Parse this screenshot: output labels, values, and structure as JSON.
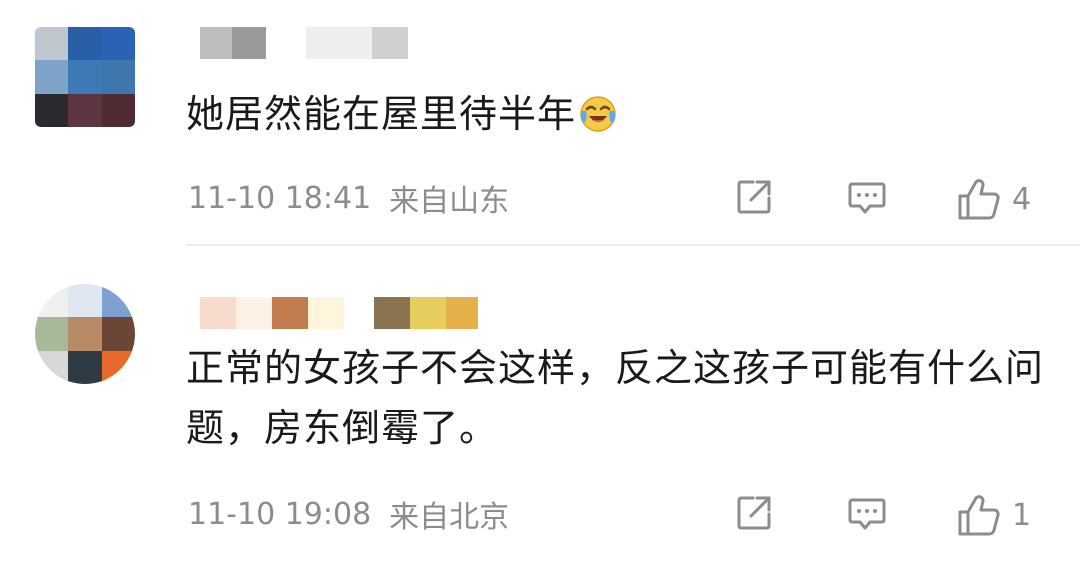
{
  "comments": [
    {
      "avatar_colors": [
        "#bfc7cf",
        "#2a5fa8",
        "#2a63b3",
        "#7ea3c8",
        "#3d79b5",
        "#3f76ae",
        "#2a2a30",
        "#5c3540",
        "#4f2a33"
      ],
      "username_blocks": [
        {
          "color": "#bdbdbd",
          "w": 32
        },
        {
          "color": "#9a9a9a",
          "w": 34
        },
        {
          "color": "#ffffff",
          "w": 40
        },
        {
          "color": "#eeeeee",
          "w": 66
        },
        {
          "color": "#cfcfcf",
          "w": 36
        }
      ],
      "content": "她居然能在屋里待半年",
      "emoji": "laughing-crying-emoji",
      "time": "11-10 18:41",
      "location": "来自山东",
      "like_count": "4"
    },
    {
      "avatar_colors": [
        "#f0f0f0",
        "#dfe7f2",
        "#7fa0d0",
        "#a8b89a",
        "#b98a68",
        "#6b4636",
        "#d8d8d8",
        "#2f3a45",
        "#e86a2a"
      ],
      "username_blocks": [
        {
          "color": "#f7dccd",
          "w": 36
        },
        {
          "color": "#fbf2e5",
          "w": 36
        },
        {
          "color": "#c27b4f",
          "w": 36
        },
        {
          "color": "#fff4dc",
          "w": 36
        },
        {
          "color": "#ffffff",
          "w": 30
        },
        {
          "color": "#8a7350",
          "w": 36
        },
        {
          "color": "#e6cd5d",
          "w": 36
        },
        {
          "color": "#e5b04a",
          "w": 32
        }
      ],
      "content": "正常的女孩子不会这样，反之这孩子可能有什么问题，房东倒霉了。",
      "time": "11-10 19:08",
      "location": "来自北京",
      "like_count": "1"
    }
  ],
  "icons": {
    "share": "share-icon",
    "reply": "reply-icon",
    "like": "like-icon"
  }
}
